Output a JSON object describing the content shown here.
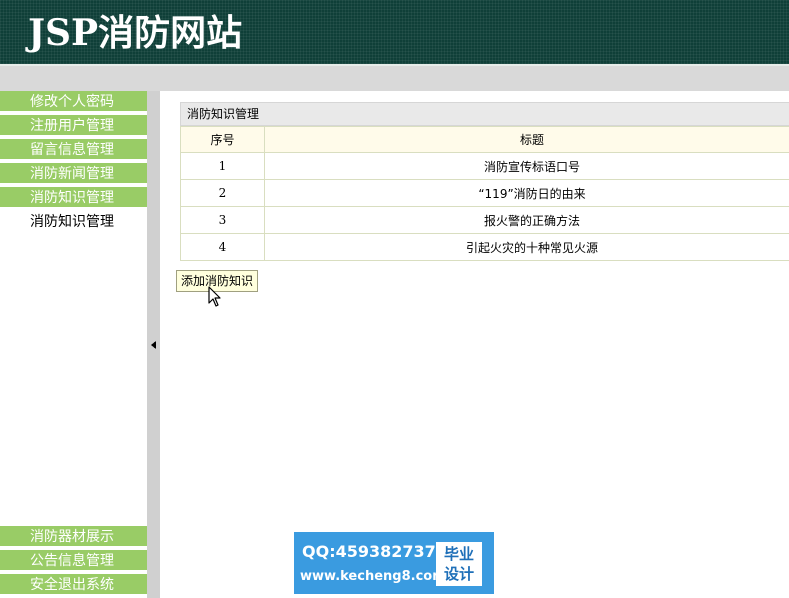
{
  "header": {
    "title": "JSP消防网站"
  },
  "sidebar": {
    "top_items": [
      {
        "label": "修改个人密码"
      },
      {
        "label": "注册用户管理"
      },
      {
        "label": "留言信息管理"
      },
      {
        "label": "消防新闻管理"
      },
      {
        "label": "消防知识管理"
      }
    ],
    "current_item": {
      "label": "消防知识管理"
    },
    "bottom_items": [
      {
        "label": "消防器材展示"
      },
      {
        "label": "公告信息管理"
      },
      {
        "label": "安全退出系统"
      }
    ]
  },
  "panel": {
    "title": "消防知识管理",
    "columns": {
      "num": "序号",
      "title": "标题"
    },
    "rows": [
      {
        "num": "1",
        "title": "消防宣传标语口号"
      },
      {
        "num": "2",
        "title": "“119”消防日的由来"
      },
      {
        "num": "3",
        "title": "报火警的正确方法"
      },
      {
        "num": "4",
        "title": "引起火灾的十种常见火源"
      }
    ],
    "add_button": "添加消防知识"
  },
  "watermark": {
    "qq": "QQ:459382737",
    "url": "www.kecheng8.com",
    "box_line1": "毕业",
    "box_line2": "设计"
  },
  "colors": {
    "header_bg": "#0f3f38",
    "menu_green": "#99cc66",
    "badge_blue": "#3a9be0"
  }
}
